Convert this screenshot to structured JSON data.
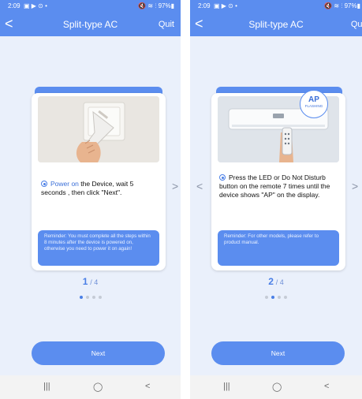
{
  "screens": [
    {
      "status": {
        "time": "2:09",
        "left_icons": "▣ ▶ ⊙ •",
        "right_icons": "🔇 ≋ ⫶ 97%▮"
      },
      "header": {
        "title": "Split-type AC",
        "quit": "Quit",
        "back": "<"
      },
      "instruction": {
        "highlight": "Power on",
        "text": " the Device, wait 5 seconds , then click \"Next\"."
      },
      "reminder": "Reminder: You must complete all the steps within 8 minutes after the device is powered on, otherwise you need to power it on again!",
      "pager": {
        "current": "1",
        "total": "/ 4"
      },
      "next_label": "Next",
      "nav": {
        "recent": "|||",
        "home": "◯",
        "back": "<"
      }
    },
    {
      "status": {
        "time": "2:09",
        "left_icons": "▣ ▶ ⊙ •",
        "right_icons": "🔇 ≋ ⫶ 97%▮"
      },
      "header": {
        "title": "Split-type AC",
        "quit": "Quit",
        "back": "<"
      },
      "ap_badge": {
        "main": "AP",
        "sub": "FLASHING"
      },
      "instruction": {
        "text": "Press the LED or Do Not Disturb button on the remote 7 times until the device shows \"AP\" on the display."
      },
      "reminder": "Reminder: For other models, please refer to product manual.",
      "pager": {
        "current": "2",
        "total": "/ 4"
      },
      "next_label": "Next",
      "nav": {
        "recent": "|||",
        "home": "◯",
        "back": "<"
      }
    }
  ],
  "arrows": {
    "prev": "<",
    "next": ">"
  }
}
